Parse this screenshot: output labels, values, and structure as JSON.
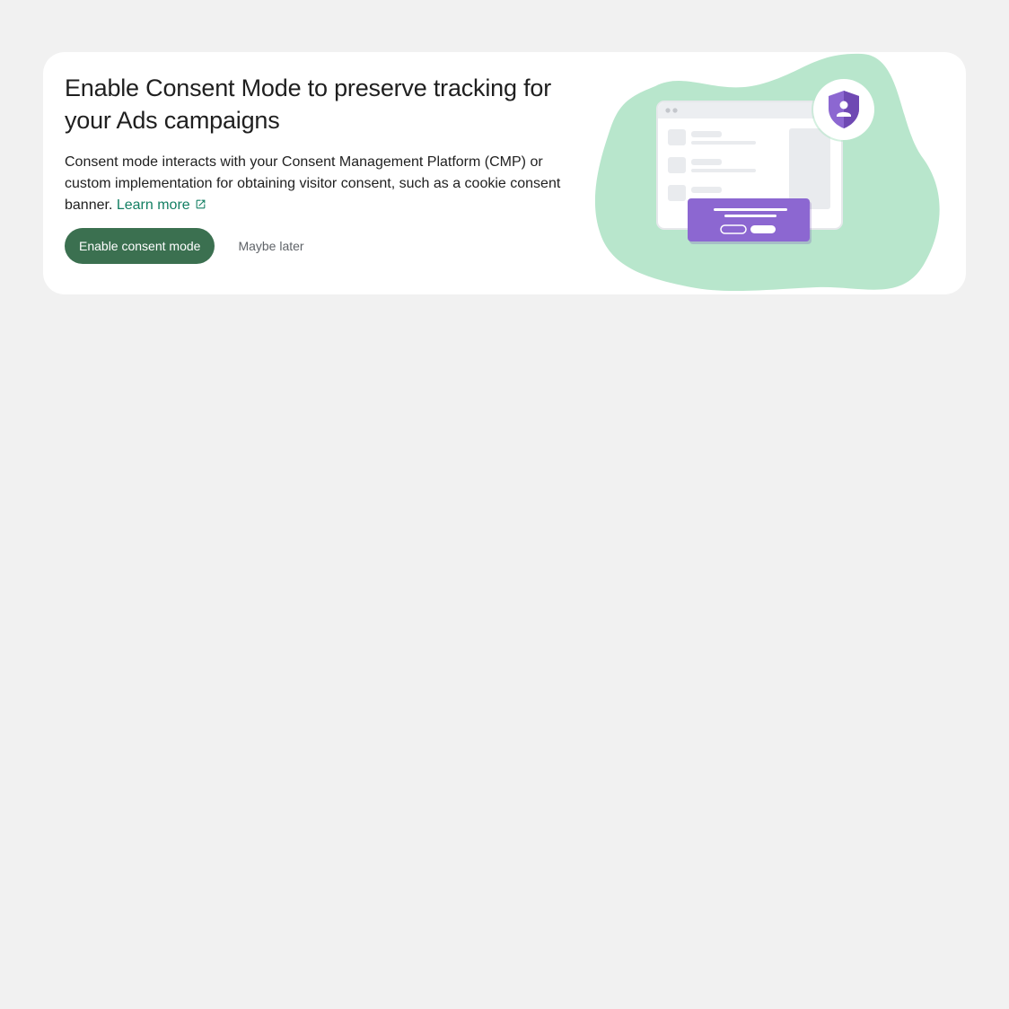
{
  "banner": {
    "title": "Enable Consent Mode to preserve tracking for your Ads campaigns",
    "description": "Consent mode interacts with your Consent Management Platform (CMP) or custom implementation for obtaining visitor consent, such as a cookie consent banner.",
    "learn_more_label": "Learn more",
    "learn_more_icon": "open-in-new-icon",
    "primary_button_label": "Enable consent mode",
    "secondary_button_label": "Maybe later",
    "illustration_icon": "privacy-shield-icon"
  },
  "colors": {
    "page_background": "#f1f1f1",
    "card_background": "#ffffff",
    "primary_button": "#3b7050",
    "link": "#137f63",
    "blob": "#b8e6cc",
    "accent_purple": "#8c67d1"
  }
}
